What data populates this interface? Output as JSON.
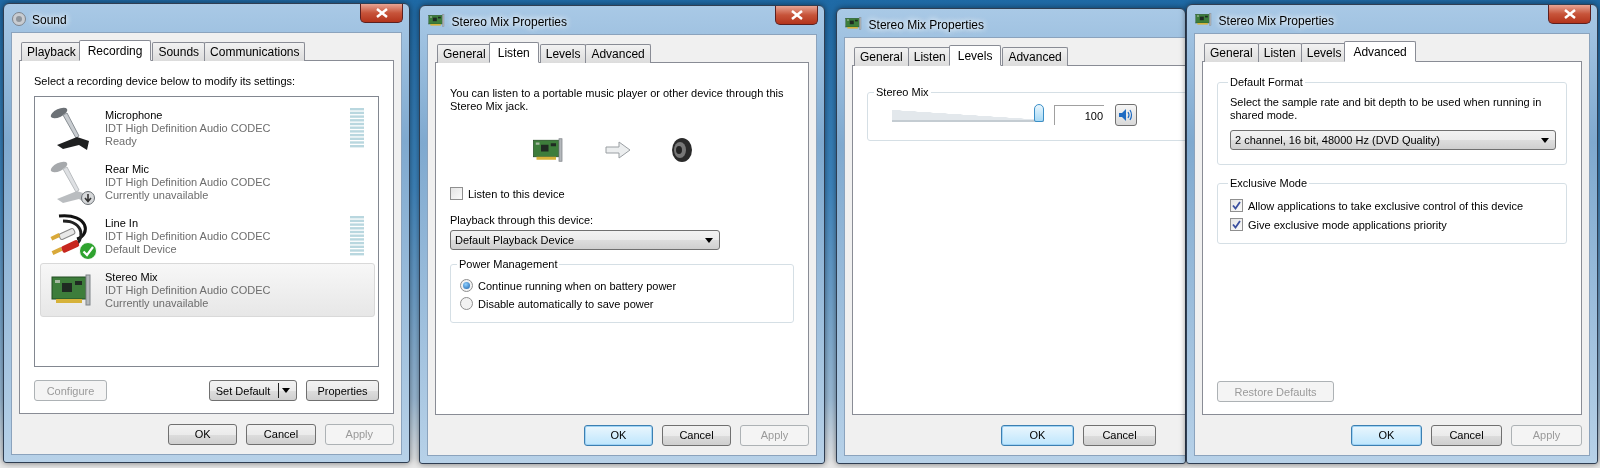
{
  "windows": [
    {
      "kind": "sound",
      "title": "Sound",
      "tabs": [
        {
          "label": "Playback",
          "selected": false
        },
        {
          "label": "Recording",
          "selected": true
        },
        {
          "label": "Sounds",
          "selected": false
        },
        {
          "label": "Communications",
          "selected": false
        }
      ],
      "instruction": "Select a recording device below to modify its settings:",
      "devices": [
        {
          "kind": "microphone",
          "name": "Microphone",
          "driver": "IDT High Definition Audio CODEC",
          "status": "Ready",
          "meter": true,
          "selected": false
        },
        {
          "kind": "unplugged_microphone",
          "name": "Rear Mic",
          "driver": "IDT High Definition Audio CODEC",
          "status": "Currently unavailable",
          "meter": false,
          "selected": false
        },
        {
          "kind": "default_line_in",
          "name": "Line In",
          "driver": "IDT High Definition Audio CODEC",
          "status": "Default Device",
          "meter": true,
          "selected": false
        },
        {
          "kind": "sound_card",
          "name": "Stereo Mix",
          "driver": "IDT High Definition Audio CODEC",
          "status": "Currently unavailable",
          "meter": false,
          "selected": true
        }
      ],
      "device_buttons": [
        {
          "kind": "plain",
          "label": "Configure",
          "disabled": true
        },
        {
          "kind": "split",
          "label": "Set Default",
          "disabled": false
        },
        {
          "kind": "plain",
          "label": "Properties",
          "disabled": false
        }
      ],
      "buttons": [
        {
          "label": "OK",
          "default": false,
          "disabled": false
        },
        {
          "label": "Cancel",
          "default": false,
          "disabled": false
        },
        {
          "label": "Apply",
          "default": false,
          "disabled": true
        }
      ]
    },
    {
      "kind": "listen",
      "title": "Stereo Mix Properties",
      "tabs": [
        {
          "label": "General",
          "selected": false
        },
        {
          "label": "Listen",
          "selected": true
        },
        {
          "label": "Levels",
          "selected": false
        },
        {
          "label": "Advanced",
          "selected": false
        }
      ],
      "description": "You can listen to a portable music player or other device through this Stereo Mix jack.",
      "listen_checkbox": {
        "label": "Listen to this device",
        "checked": false
      },
      "playback_label": "Playback through this device:",
      "playback_dropdown": {
        "value": "Default Playback Device"
      },
      "power_group": {
        "title": "Power Management",
        "options": [
          {
            "label": "Continue running when on battery power",
            "selected": true
          },
          {
            "label": "Disable automatically to save power",
            "selected": false
          }
        ]
      },
      "buttons": [
        {
          "label": "OK",
          "default": true,
          "disabled": false
        },
        {
          "label": "Cancel",
          "default": false,
          "disabled": false
        },
        {
          "label": "Apply",
          "default": false,
          "disabled": true
        }
      ]
    },
    {
      "kind": "levels",
      "title": "Stereo Mix Properties",
      "tabs": [
        {
          "label": "General",
          "selected": false
        },
        {
          "label": "Listen",
          "selected": false
        },
        {
          "label": "Levels",
          "selected": true
        },
        {
          "label": "Advanced",
          "selected": false
        }
      ],
      "channels": [
        {
          "name": "Stereo Mix",
          "level": 1,
          "value": "100",
          "muted": false
        }
      ],
      "buttons": [
        {
          "label": "OK",
          "default": true,
          "disabled": false
        },
        {
          "label": "Cancel",
          "default": false,
          "disabled": false
        }
      ]
    },
    {
      "kind": "advanced",
      "title": "Stereo Mix Properties",
      "tabs": [
        {
          "label": "General",
          "selected": false
        },
        {
          "label": "Listen",
          "selected": false
        },
        {
          "label": "Levels",
          "selected": false
        },
        {
          "label": "Advanced",
          "selected": true
        }
      ],
      "format_group": {
        "title": "Default Format",
        "text": "Select the sample rate and bit depth to be used when running in shared mode.",
        "dropdown": {
          "value": "2 channel, 16 bit, 48000 Hz (DVD Quality)"
        }
      },
      "exclusive_group": {
        "title": "Exclusive Mode",
        "options": [
          {
            "label": "Allow applications to take exclusive control of this device",
            "checked": true
          },
          {
            "label": "Give exclusive mode applications priority",
            "checked": true
          }
        ]
      },
      "restore_button": {
        "label": "Restore Defaults",
        "disabled": true
      },
      "buttons": [
        {
          "label": "OK",
          "default": true,
          "disabled": false
        },
        {
          "label": "Cancel",
          "default": false,
          "disabled": false
        },
        {
          "label": "Apply",
          "default": false,
          "disabled": true
        }
      ]
    }
  ]
}
